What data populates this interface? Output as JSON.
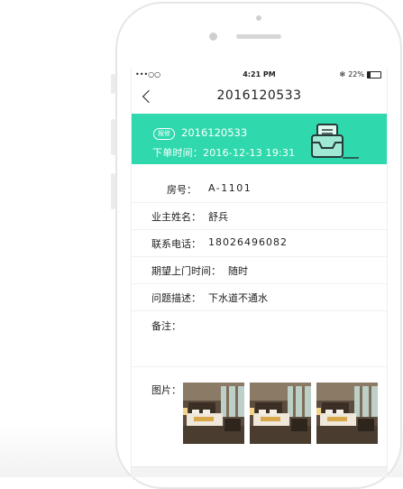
{
  "status_bar": {
    "signal": "•••○○",
    "time": "4:21 PM",
    "bluetooth": "✻",
    "battery_text": "22%",
    "battery_level": 0.22
  },
  "nav": {
    "title": "2016120533",
    "back_icon": "chevron-left-icon"
  },
  "order": {
    "tag": "报修",
    "number": "2016120533",
    "time_label": "下单时间：",
    "time_value": "2016-12-13 19:31",
    "icon": "inbox-tray-icon"
  },
  "details": {
    "room_label": "房号：",
    "room_value": "A-1101",
    "owner_label": "业主姓名：",
    "owner_value": "舒兵",
    "phone_label": "联系电话：",
    "phone_value": "18026496082",
    "visit_label": "期望上门时间：",
    "visit_value": "随时",
    "issue_label": "问题描述：",
    "issue_value": "下水道不通水",
    "note_label": "备注：",
    "photos_label": "图片："
  },
  "photos": [
    "hotel-room-photo",
    "hotel-room-photo",
    "hotel-room-photo"
  ],
  "colors": {
    "accent": "#2fd9ad",
    "text": "#222222",
    "divider": "#f0f0f0"
  }
}
